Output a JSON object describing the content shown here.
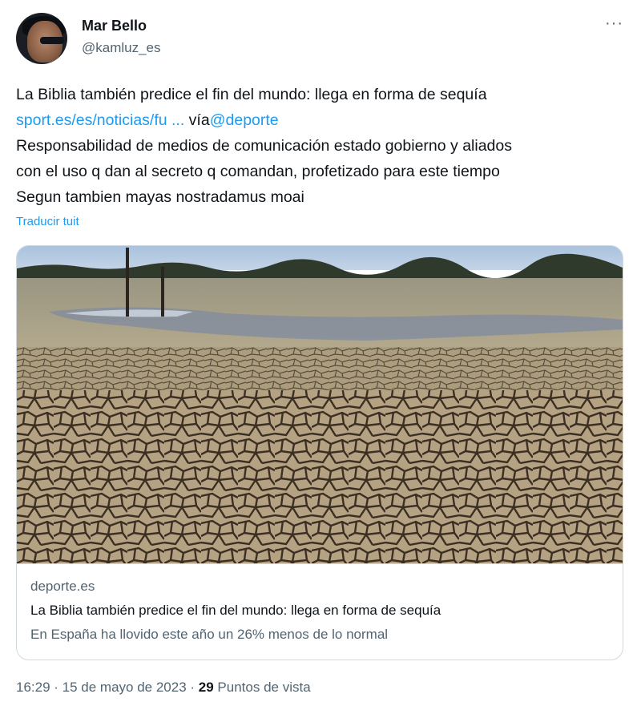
{
  "user": {
    "name": "Mar Bello",
    "handle": "@kamluz_es",
    "more_label": "···"
  },
  "tweet": {
    "line1": "La Biblia también predice el fin del mundo: llega en forma de sequía",
    "link_text": "sport.es/es/noticias/fu ...",
    "via_text": " vía",
    "mention": "@deporte",
    "line3": "Responsabilidad de medios de comunicación estado gobierno y aliados",
    "line4": "con el uso q dan al secreto q comandan, profetizado para este tiempo",
    "line5": "Segun tambien mayas nostradamus moai",
    "translate_label": "Traducir tuit"
  },
  "card": {
    "domain": "deporte.es",
    "title": "La Biblia también predice el fin del mundo: llega en forma de sequía",
    "description": "En España ha llovido este año un 26% menos de lo normal",
    "image_icon": "dry-cracked-earth-photo"
  },
  "footer": {
    "time": "16:29",
    "sep1": " · ",
    "date": "15 de mayo de 2023",
    "sep2": " · ",
    "views_count": "29",
    "views_label": " Puntos de vista"
  },
  "colors": {
    "link": "#1d9bf0",
    "secondary_text": "#536471",
    "primary_text": "#0f1419",
    "border": "#cfd9de"
  }
}
